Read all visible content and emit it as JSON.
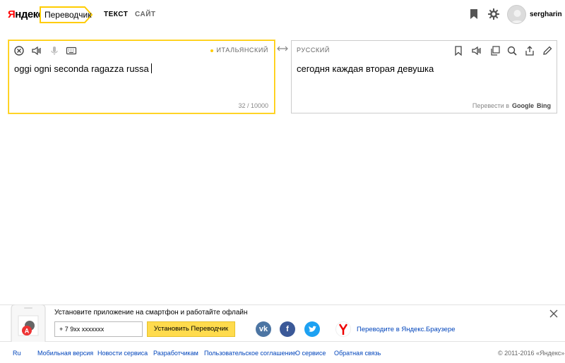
{
  "header": {
    "logo_first": "Я",
    "logo_rest": "ндекс",
    "service_name": "Переводчик",
    "tabs": [
      {
        "label": "ТЕКСТ",
        "active": true
      },
      {
        "label": "САЙТ",
        "active": false
      }
    ],
    "icons": [
      "bookmark-icon",
      "gear-icon"
    ],
    "username": "sergharin"
  },
  "source_panel": {
    "language": "ИТАЛЬЯНСКИЙ",
    "text": "oggi ogni seconda ragazza russa",
    "counter": "32 / 10000",
    "tools": [
      "clear-icon",
      "speaker-icon",
      "microphone-icon",
      "keyboard-icon"
    ]
  },
  "target_panel": {
    "language": "РУССКИЙ",
    "text": "сегодня каждая вторая девушка",
    "translate_in_label": "Перевести в",
    "engines": [
      "Google",
      "Bing"
    ],
    "tools": [
      "bookmark-icon",
      "speaker-icon",
      "copy-icon",
      "search-icon",
      "share-icon",
      "edit-icon"
    ]
  },
  "promo": {
    "title": "Установите приложение на смартфон и работайте офлайн",
    "phone_value": "+ 7  9xx xxxxxxx",
    "install_button": "Установить Переводчик",
    "browser_link": "Переводите в Яндекс.Браузере",
    "socials": [
      "vk",
      "facebook",
      "twitter"
    ]
  },
  "footer": {
    "links": [
      "Ru",
      "Мобильная версия",
      "Новости сервиса",
      "Разработчикам",
      "Пользовательское соглашение",
      "О сервисе",
      "Обратная связь"
    ],
    "copyright": "© 2011-2016 «Яндекс»"
  },
  "colors": {
    "accent_yellow": "#ffdb4d",
    "link_blue": "#0044bb",
    "vk": "#4c75a3",
    "facebook": "#3b5998",
    "twitter": "#1da1f2"
  }
}
